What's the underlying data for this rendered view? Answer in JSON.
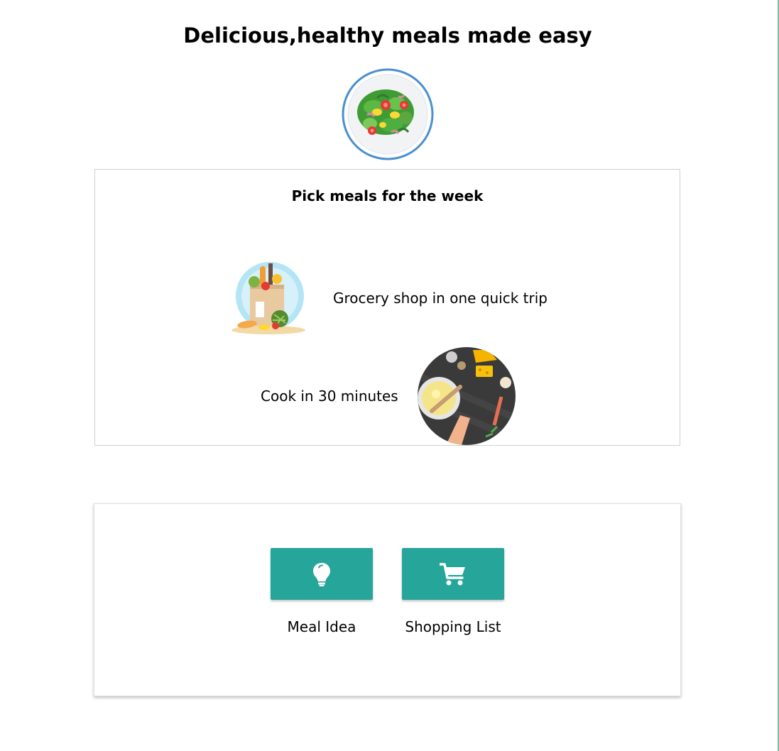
{
  "header": {
    "title": "Delicious,healthy meals made easy"
  },
  "hero": {
    "image_icon": "salad-plate-illustration"
  },
  "features": {
    "title": "Pick meals for the week",
    "items": [
      {
        "text": "Grocery shop in one quick trip",
        "image_icon": "grocery-bag-illustration"
      },
      {
        "text": "Cook in 30 minutes",
        "image_icon": "cooking-bowl-illustration"
      }
    ]
  },
  "actions": {
    "buttons": [
      {
        "label": "Meal Idea",
        "icon": "lightbulb-icon"
      },
      {
        "label": "Shopping List",
        "icon": "shopping-cart-icon"
      }
    ],
    "button_color": "#26a69a",
    "icon_color": "#ffffff"
  }
}
